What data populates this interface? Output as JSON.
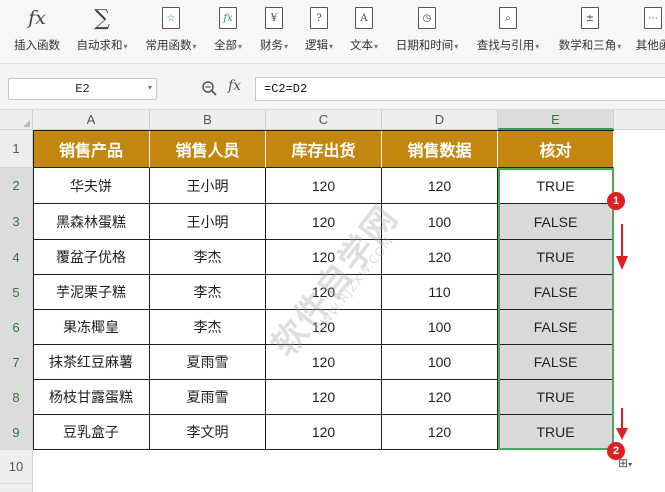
{
  "ribbon": {
    "items": [
      {
        "label": "插入函数",
        "icon": "fx-icon",
        "dropdown": false
      },
      {
        "label": "自动求和",
        "icon": "sigma-icon",
        "dropdown": true
      },
      {
        "label": "常用函数",
        "icon": "common-functions-icon",
        "dropdown": true
      },
      {
        "label": "全部",
        "icon": "all-functions-icon",
        "dropdown": true
      },
      {
        "label": "财务",
        "icon": "finance-icon",
        "dropdown": true
      },
      {
        "label": "逻辑",
        "icon": "logic-icon",
        "dropdown": true
      },
      {
        "label": "文本",
        "icon": "text-icon",
        "dropdown": true
      },
      {
        "label": "日期和时间",
        "icon": "datetime-icon",
        "dropdown": true
      },
      {
        "label": "查找与引用",
        "icon": "lookup-icon",
        "dropdown": true
      },
      {
        "label": "数学和三角",
        "icon": "math-icon",
        "dropdown": true
      },
      {
        "label": "其他函",
        "icon": "other-functions-icon",
        "dropdown": false
      }
    ],
    "icon_glyphs": {
      "finance": "¥",
      "logic": "?",
      "text": "A"
    }
  },
  "formula_bar": {
    "name_box": "E2",
    "fx_label": "fx",
    "formula": "=C2=D2"
  },
  "grid": {
    "columns": [
      "A",
      "B",
      "C",
      "D",
      "E"
    ],
    "selected_column": "E",
    "rows": [
      "1",
      "2",
      "3",
      "4",
      "5",
      "6",
      "7",
      "8",
      "9",
      "10"
    ],
    "selected_rows": [
      "2",
      "3",
      "4",
      "5",
      "6",
      "7",
      "8",
      "9"
    ],
    "header": [
      "销售产品",
      "销售人员",
      "库存出货",
      "销售数据",
      "核对"
    ],
    "data": [
      [
        "华夫饼",
        "王小明",
        "120",
        "120",
        "TRUE"
      ],
      [
        "黑森林蛋糕",
        "王小明",
        "120",
        "100",
        "FALSE"
      ],
      [
        "覆盆子优格",
        "李杰",
        "120",
        "120",
        "TRUE"
      ],
      [
        "芋泥栗子糕",
        "李杰",
        "120",
        "110",
        "FALSE"
      ],
      [
        "果冻椰皇",
        "李杰",
        "120",
        "100",
        "FALSE"
      ],
      [
        "抹茶红豆麻薯",
        "夏雨雪",
        "120",
        "100",
        "FALSE"
      ],
      [
        "杨枝甘露蛋糕",
        "夏雨雪",
        "120",
        "120",
        "TRUE"
      ],
      [
        "豆乳盒子",
        "李文明",
        "120",
        "120",
        "TRUE"
      ]
    ]
  },
  "annotations": {
    "marker1": "1",
    "marker2": "2"
  },
  "watermark": {
    "main": "软件自学网",
    "sub": "WWW.RJZXW.COM"
  },
  "colors": {
    "header_fill": "#c3860f",
    "selection": "#4ea85a",
    "marker": "#e02020",
    "filled_cell": "#d9d9d9"
  }
}
